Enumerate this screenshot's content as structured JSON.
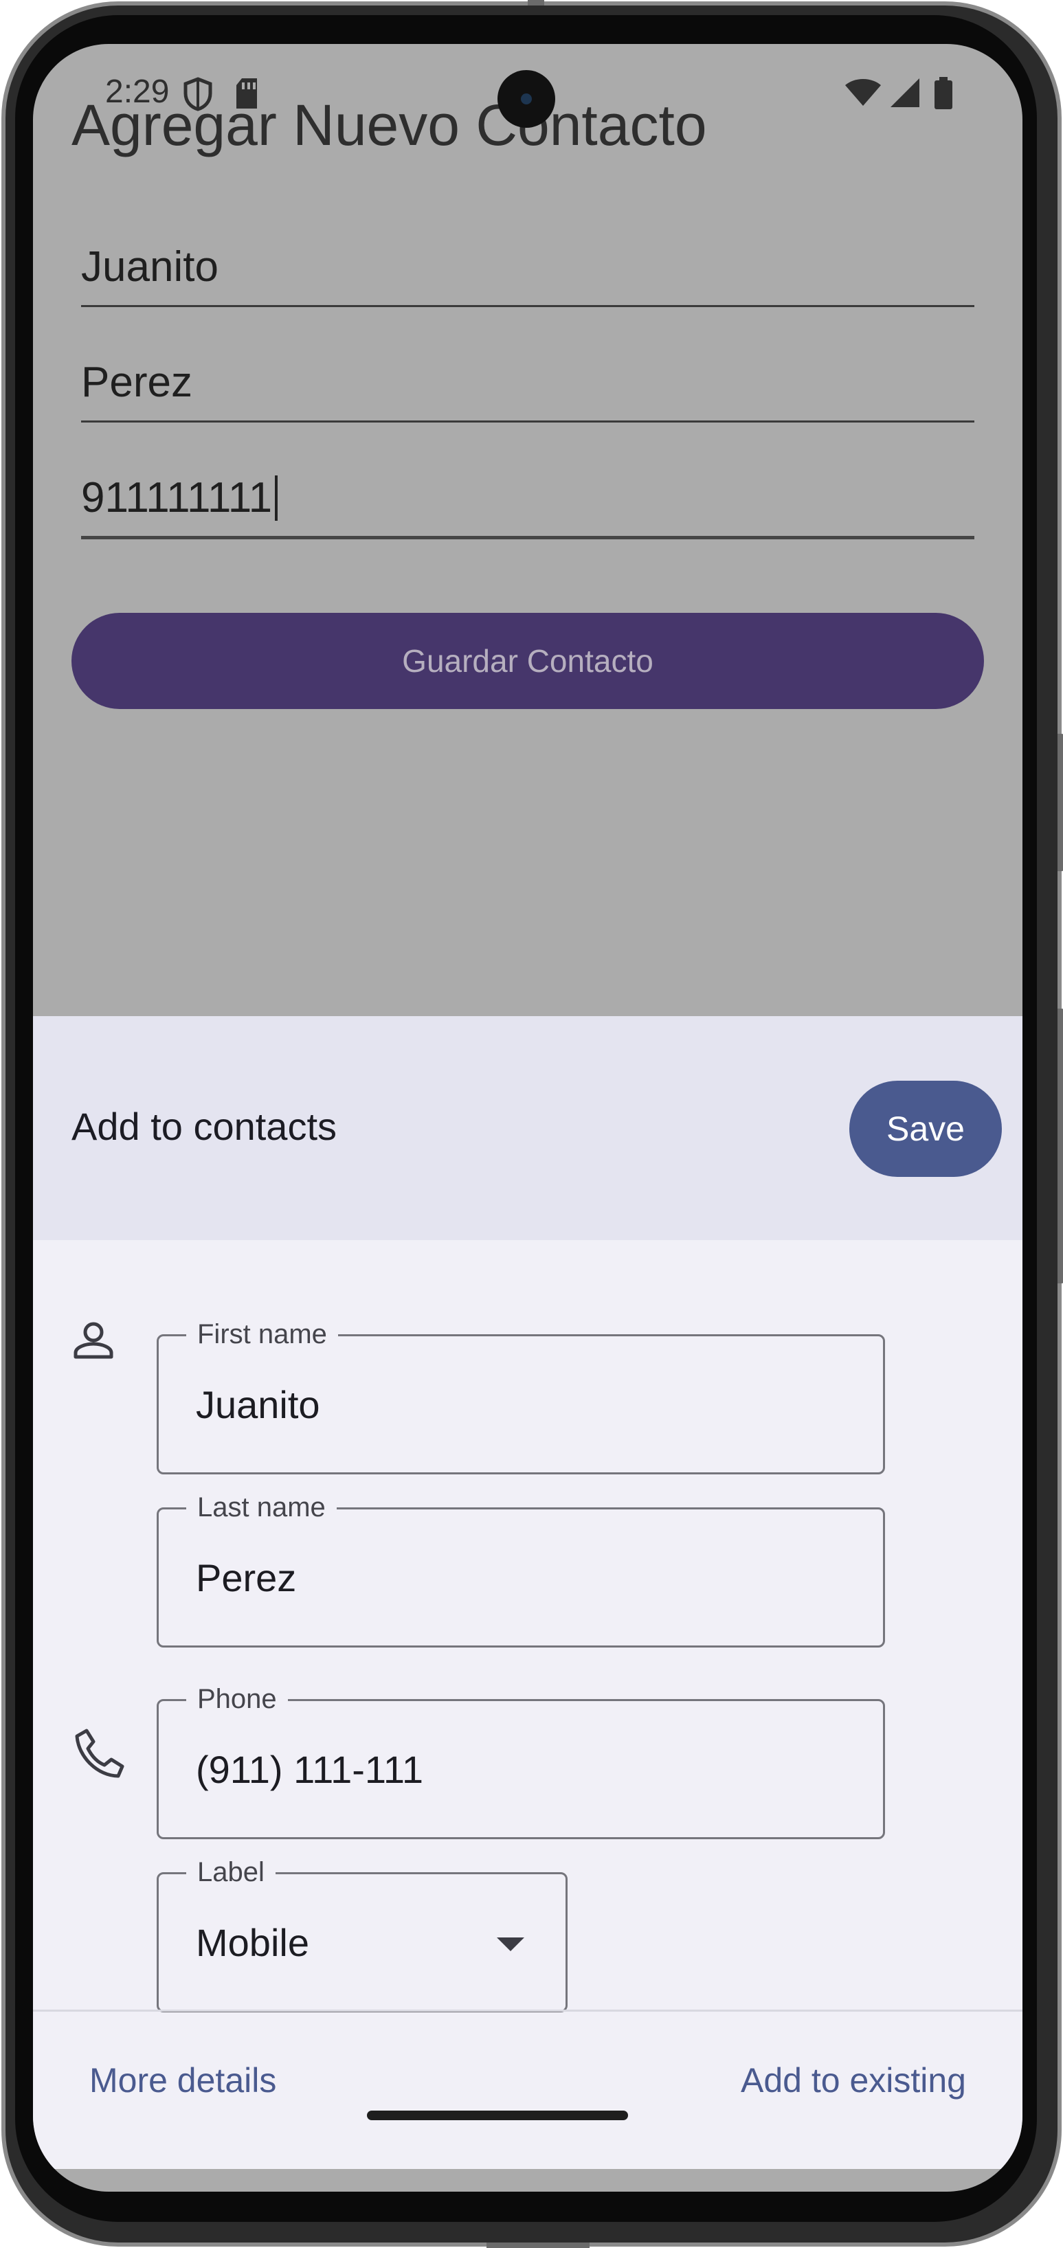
{
  "status_bar": {
    "time": "2:29",
    "icons": [
      "shield-icon",
      "sd-card-icon",
      "wifi-icon",
      "signal-icon",
      "battery-icon"
    ]
  },
  "app": {
    "title": "Agregar Nuevo Contacto",
    "fields": [
      {
        "name": "first-name",
        "value": "Juanito"
      },
      {
        "name": "last-name",
        "value": "Perez"
      },
      {
        "name": "phone",
        "value": "911111111"
      }
    ],
    "save_button": "Guardar Contacto"
  },
  "sheet": {
    "title": "Add to contacts",
    "save_label": "Save",
    "first_name": {
      "label": "First name",
      "value": "Juanito"
    },
    "last_name": {
      "label": "Last name",
      "value": "Perez"
    },
    "phone": {
      "label": "Phone",
      "value": "(911) 111-111"
    },
    "phone_label": {
      "label": "Label",
      "value": "Mobile"
    },
    "more_details": "More details",
    "add_existing": "Add to existing"
  },
  "colors": {
    "scrim": "#ababab",
    "primary_button": "#46366b",
    "accent": "#4a5a8f",
    "sheet_header": "#e4e4f0",
    "sheet_body": "#f1f0f7"
  }
}
